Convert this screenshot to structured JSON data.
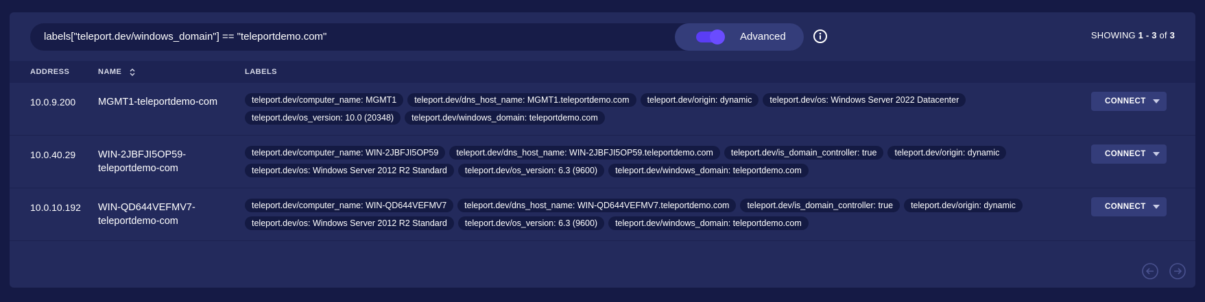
{
  "search": {
    "query": "labels[\"teleport.dev/windows_domain\"] == \"teleportdemo.com\"",
    "advanced_label": "Advanced"
  },
  "showing": {
    "prefix": "SHOWING",
    "range": "1 - 3",
    "of": "of",
    "total": "3"
  },
  "columns": {
    "address": "ADDRESS",
    "name": "NAME",
    "labels": "LABELS"
  },
  "connect_label": "CONNECT",
  "rows": [
    {
      "address": "10.0.9.200",
      "name": "MGMT1-teleportdemo-com",
      "labels": [
        "teleport.dev/computer_name: MGMT1",
        "teleport.dev/dns_host_name: MGMT1.teleportdemo.com",
        "teleport.dev/origin: dynamic",
        "teleport.dev/os: Windows Server 2022 Datacenter",
        "teleport.dev/os_version: 10.0 (20348)",
        "teleport.dev/windows_domain: teleportdemo.com"
      ]
    },
    {
      "address": "10.0.40.29",
      "name": "WIN-2JBFJI5OP59-teleportdemo-com",
      "labels": [
        "teleport.dev/computer_name: WIN-2JBFJI5OP59",
        "teleport.dev/dns_host_name: WIN-2JBFJI5OP59.teleportdemo.com",
        "teleport.dev/is_domain_controller: true",
        "teleport.dev/origin: dynamic",
        "teleport.dev/os: Windows Server 2012 R2 Standard",
        "teleport.dev/os_version: 6.3 (9600)",
        "teleport.dev/windows_domain: teleportdemo.com"
      ]
    },
    {
      "address": "10.0.10.192",
      "name": "WIN-QD644VEFMV7-teleportdemo-com",
      "labels": [
        "teleport.dev/computer_name: WIN-QD644VEFMV7",
        "teleport.dev/dns_host_name: WIN-QD644VEFMV7.teleportdemo.com",
        "teleport.dev/is_domain_controller: true",
        "teleport.dev/origin: dynamic",
        "teleport.dev/os: Windows Server 2012 R2 Standard",
        "teleport.dev/os_version: 6.3 (9600)",
        "teleport.dev/windows_domain: teleportdemo.com"
      ]
    }
  ],
  "icons": {
    "info": "info-icon",
    "sort": "sort-icon",
    "caret": "caret-down-icon",
    "prev": "arrow-left-circle-icon",
    "next": "arrow-right-circle-icon"
  },
  "colors": {
    "accent": "#5a3df5",
    "panel": "#232a5c",
    "background": "#151a45"
  }
}
